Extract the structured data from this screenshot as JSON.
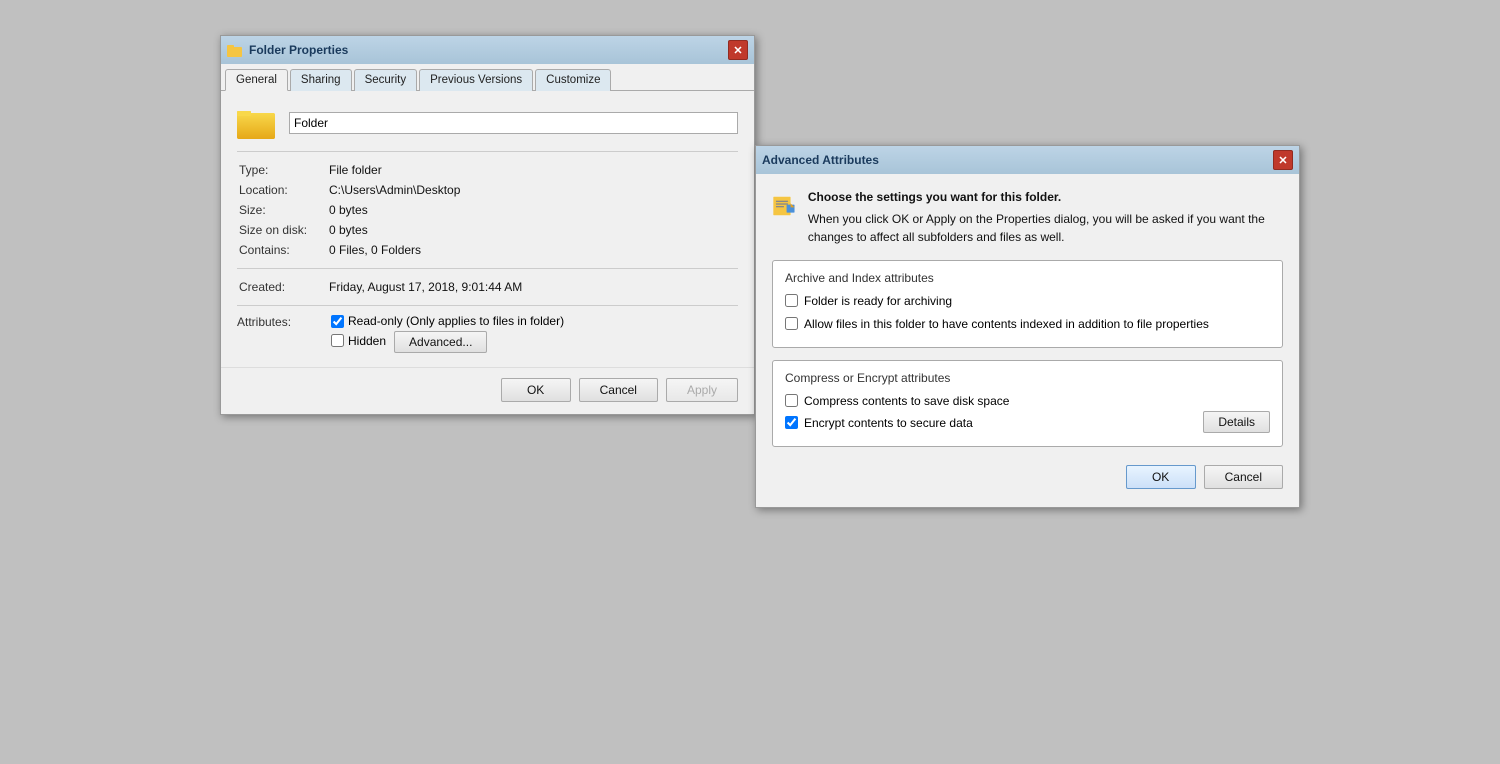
{
  "folderProps": {
    "title": "Folder Properties",
    "tabs": [
      {
        "label": "General",
        "active": true
      },
      {
        "label": "Sharing",
        "active": false
      },
      {
        "label": "Security",
        "active": false
      },
      {
        "label": "Previous Versions",
        "active": false
      },
      {
        "label": "Customize",
        "active": false
      }
    ],
    "folderName": "Folder",
    "fields": [
      {
        "label": "Type:",
        "value": "File folder"
      },
      {
        "label": "Location:",
        "value": "C:\\Users\\Admin\\Desktop"
      },
      {
        "label": "Size:",
        "value": "0 bytes"
      },
      {
        "label": "Size on disk:",
        "value": "0 bytes"
      },
      {
        "label": "Contains:",
        "value": "0 Files, 0 Folders"
      }
    ],
    "created": {
      "label": "Created:",
      "value": "Friday, August 17, 2018, 9:01:44 AM"
    },
    "attributes": {
      "label": "Attributes:",
      "readOnly": {
        "label": "Read-only (Only applies to files in folder)",
        "checked": true
      },
      "hidden": {
        "label": "Hidden",
        "checked": false
      },
      "advancedBtn": "Advanced..."
    },
    "buttons": {
      "ok": "OK",
      "cancel": "Cancel",
      "apply": "Apply"
    }
  },
  "advancedAttrs": {
    "title": "Advanced Attributes",
    "description": {
      "line1": "Choose the settings you want for this folder.",
      "line2": "When you click OK or Apply on the Properties dialog, you will be asked if you want the changes to affect all subfolders and files as well."
    },
    "archiveSection": {
      "title": "Archive and Index attributes",
      "items": [
        {
          "label": "Folder is ready for archiving",
          "checked": false
        },
        {
          "label": "Allow files in this folder to have contents indexed in addition to file properties",
          "checked": false
        }
      ]
    },
    "encryptSection": {
      "title": "Compress or Encrypt attributes",
      "items": [
        {
          "label": "Compress contents to save disk space",
          "checked": false
        },
        {
          "label": "Encrypt contents to secure data",
          "checked": true
        }
      ]
    },
    "detailsBtn": "Details",
    "buttons": {
      "ok": "OK",
      "cancel": "Cancel"
    }
  }
}
